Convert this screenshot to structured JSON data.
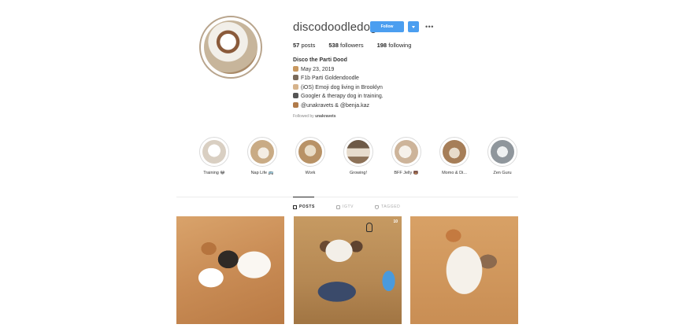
{
  "profile": {
    "username": "discodoodledog",
    "follow_label": "Follow",
    "stats": {
      "posts_count": "57",
      "posts_label": "posts",
      "followers_count": "538",
      "followers_label": "followers",
      "following_count": "198",
      "following_label": "following"
    },
    "bio": {
      "name": "Disco the Parti Dood",
      "lines": [
        "May 23, 2019",
        "F1b Parti Goldendoodle",
        "(iOS) Emoji dog living in Brooklyn",
        "Googler & therapy dog in training.",
        "@unakravets & @benja.kaz"
      ]
    },
    "followed_by_prefix": "Followed by",
    "followed_by_user": "unakravets"
  },
  "highlights": [
    {
      "label": "Training 😂",
      "color": "#e9e2d8"
    },
    {
      "label": "Nap Life 🚌",
      "color": "#d8c2a4"
    },
    {
      "label": "Work",
      "color": "#c7a67e"
    },
    {
      "label": "Growing!",
      "color": "#8f7257"
    },
    {
      "label": "BFF Jelly 🐻",
      "color": "#dcc9b3"
    },
    {
      "label": "Momo & Di...",
      "color": "#b8906a"
    },
    {
      "label": "Zen Guru",
      "color": "#9aa1a8"
    }
  ],
  "tabs": [
    {
      "label": "POSTS",
      "active": true
    },
    {
      "label": "IGTV",
      "active": false
    },
    {
      "label": "TAGGED",
      "active": false
    }
  ],
  "posts": [
    {
      "badge": ""
    },
    {
      "badge": "10"
    },
    {
      "badge": ""
    }
  ],
  "colors": {
    "accent": "#4b9ef0",
    "avatar_ring": "#b8a48c"
  }
}
